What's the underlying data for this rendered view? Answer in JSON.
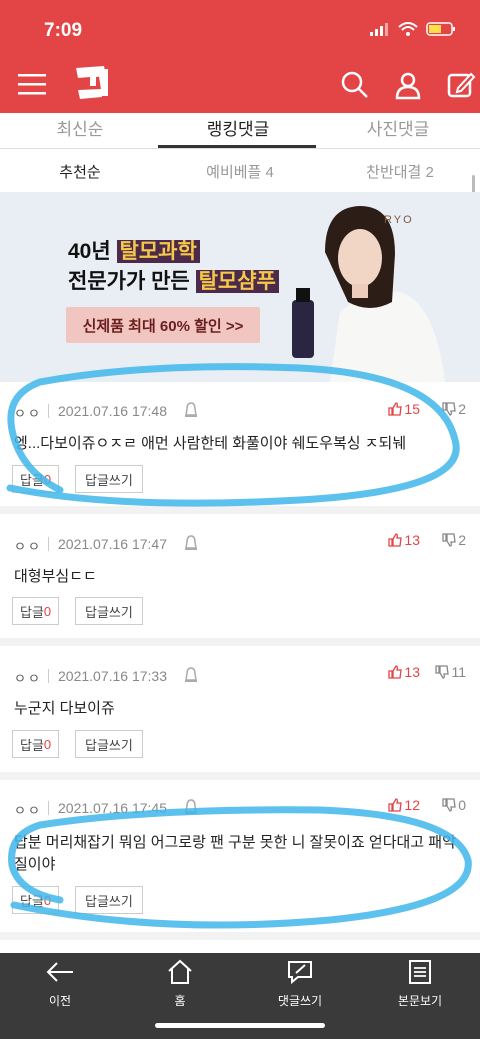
{
  "status": {
    "time": "7:09"
  },
  "header": {
    "logo_text": "판"
  },
  "tabs": [
    {
      "label": "최신순"
    },
    {
      "label": "랭킹댓글"
    },
    {
      "label": "사진댓글"
    }
  ],
  "subtabs": [
    {
      "label": "추천순"
    },
    {
      "label": "예비베플 4"
    },
    {
      "label": "찬반대결 2"
    }
  ],
  "ad": {
    "line1_prefix": "40년 ",
    "line1_highlight": "탈모과학",
    "line2_prefix": "전문가가 만든 ",
    "line2_highlight": "탈모샴푸",
    "cta": "신제품 최대 60% 할인 >>",
    "brand": "RYO"
  },
  "comments": [
    {
      "author": "ㅇㅇ",
      "date": "2021.07.16 17:48",
      "likes": "15",
      "dislikes": "2",
      "text": "엥...다보이쥬ㅇㅈㄹ 애먼 사람한테 화풀이야 쉐도우복싱 ㅈ되눼",
      "reply_label": "답글",
      "reply_count": "0",
      "write_label": "답글쓰기"
    },
    {
      "author": "ㅇㅇ",
      "date": "2021.07.16 17:47",
      "likes": "13",
      "dislikes": "2",
      "text": "대형부심ㄷㄷ",
      "reply_label": "답글",
      "reply_count": "0",
      "write_label": "답글쓰기"
    },
    {
      "author": "ㅇㅇ",
      "date": "2021.07.16 17:33",
      "likes": "13",
      "dislikes": "11",
      "text": "누군지 다보이쥬",
      "reply_label": "답글",
      "reply_count": "0",
      "write_label": "답글쓰기"
    },
    {
      "author": "ㅇㅇ",
      "date": "2021.07.16 17:45",
      "likes": "12",
      "dislikes": "0",
      "text": "답분 머리채잡기 뭐임 어그로랑 팬 구분 못한 니 잘못이죠 얻다대고 패악질이야",
      "reply_label": "답글",
      "reply_count": "0",
      "write_label": "답글쓰기"
    }
  ],
  "bottom_nav": [
    {
      "label": "이전",
      "icon": "back-arrow-icon"
    },
    {
      "label": "홈",
      "icon": "home-icon"
    },
    {
      "label": "댓글쓰기",
      "icon": "write-comment-icon"
    },
    {
      "label": "본문보기",
      "icon": "document-icon"
    }
  ],
  "colors": {
    "brand_red": "#e34446",
    "bottom_bar": "#3a3a3a",
    "annotation_blue": "#3fb6ea"
  }
}
